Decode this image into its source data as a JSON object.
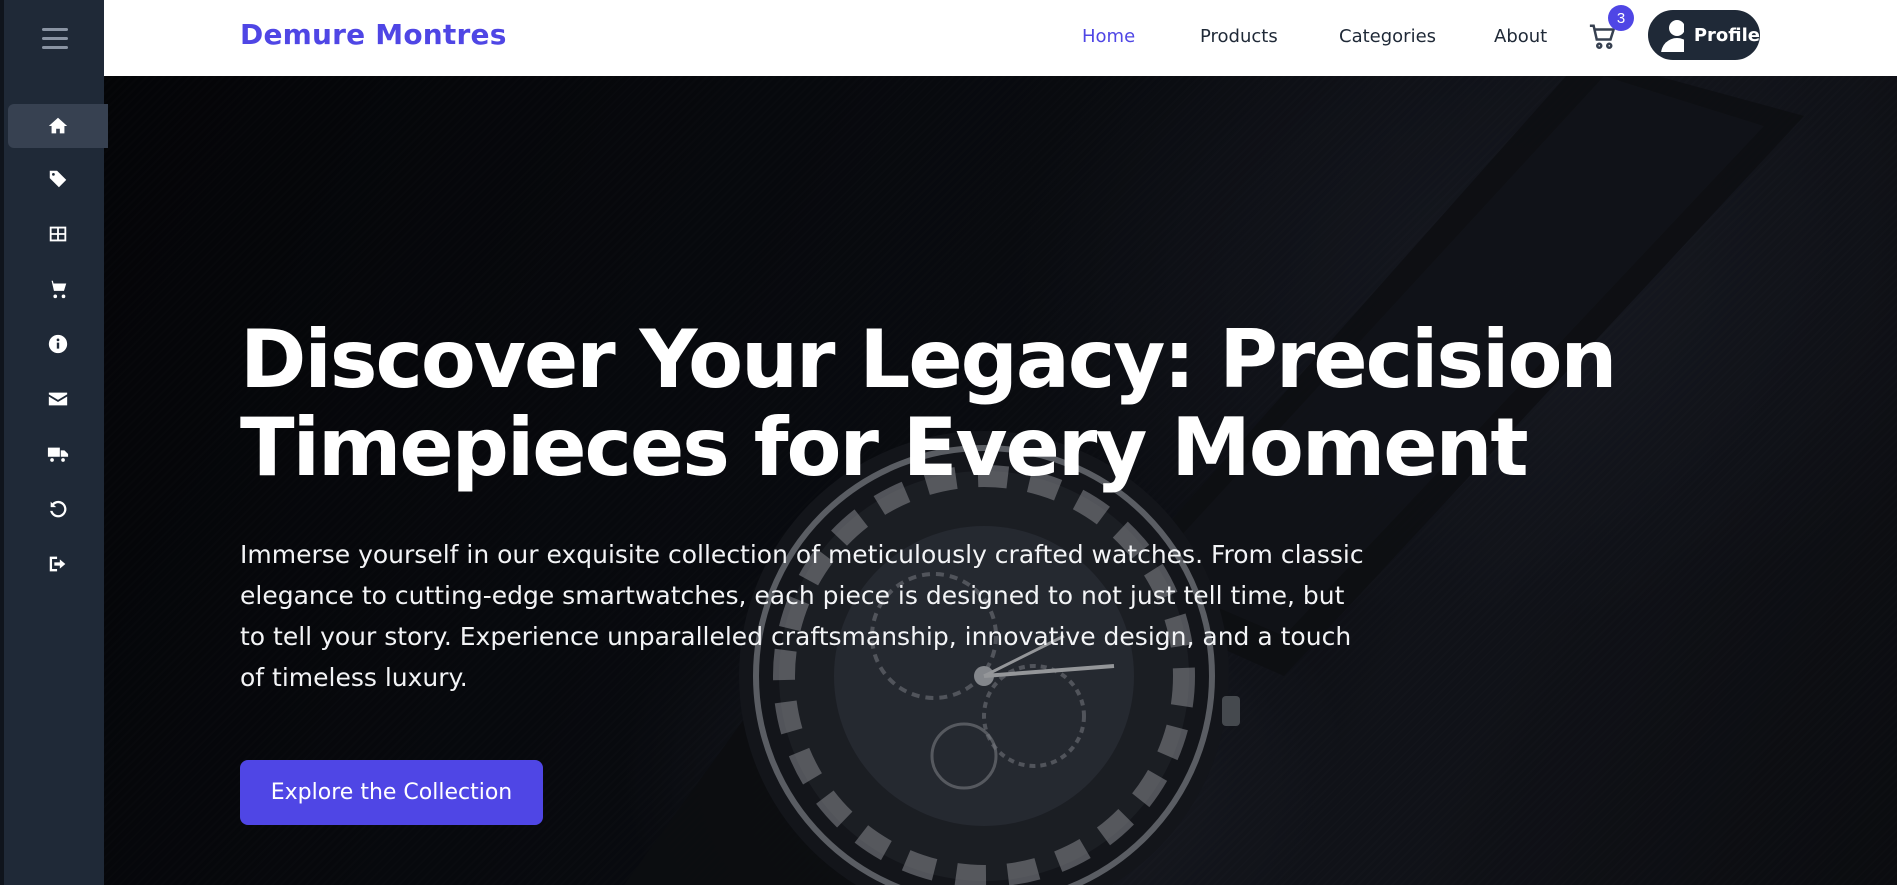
{
  "brand": {
    "name": "Demure Montres",
    "color": "#4f46e5"
  },
  "sidebar": {
    "menu_icon": "hamburger-menu-icon",
    "items": [
      {
        "icon": "home-icon",
        "active": true
      },
      {
        "icon": "tag-icon",
        "active": false
      },
      {
        "icon": "grid-icon",
        "active": false
      },
      {
        "icon": "cart-icon",
        "active": false
      },
      {
        "icon": "info-icon",
        "active": false
      },
      {
        "icon": "envelope-icon",
        "active": false
      },
      {
        "icon": "truck-icon",
        "active": false
      },
      {
        "icon": "undo-icon",
        "active": false
      },
      {
        "icon": "sign-out-icon",
        "active": false
      }
    ]
  },
  "nav": {
    "links": [
      {
        "label": "Home",
        "active": true
      },
      {
        "label": "Products",
        "active": false
      },
      {
        "label": "Categories",
        "active": false
      },
      {
        "label": "About",
        "active": false
      }
    ],
    "cart_count": "3",
    "profile_label": "Profile"
  },
  "hero": {
    "title": "Discover Your Legacy: Precision Timepieces for Every Moment",
    "description": "Immerse yourself in our exquisite collection of meticulously crafted watches. From classic elegance to cutting-edge smartwatches, each piece is designed to not just tell time, but to tell your story. Experience unparalleled craftsmanship, innovative design, and a touch of timeless luxury.",
    "cta_label": "Explore the Collection"
  },
  "colors": {
    "accent": "#4f46e5",
    "sidebar_bg": "#1f2937",
    "sidebar_active": "#374151"
  }
}
